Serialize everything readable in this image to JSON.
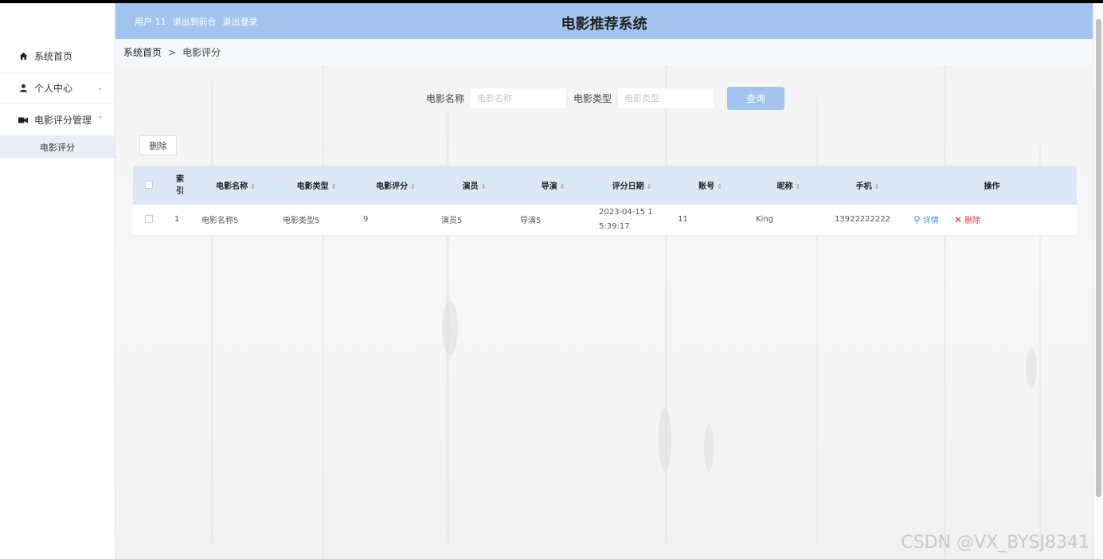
{
  "header": {
    "user_label": "用户 11",
    "to_front_label": "退出到前台",
    "logout_label": "退出登录",
    "title": "电影推荐系统",
    "color": "#a3c4ee"
  },
  "sidebar": {
    "items": [
      {
        "label": "系统首页",
        "icon": "home-icon"
      },
      {
        "label": "个人中心",
        "icon": "user-icon"
      },
      {
        "label": "电影评分管理",
        "icon": "film-icon"
      }
    ],
    "sub_items": [
      {
        "label": "电影评分"
      }
    ]
  },
  "breadcrumb": {
    "home": "系统首页",
    "separator": ">",
    "current": "电影评分"
  },
  "search": {
    "name_label": "电影名称",
    "name_placeholder": "电影名称",
    "type_label": "电影类型",
    "type_placeholder": "电影类型",
    "query_button": "查询"
  },
  "toolbar": {
    "delete_label": "删除"
  },
  "table": {
    "headers": {
      "index": "索引",
      "movie_name": "电影名称",
      "movie_type": "电影类型",
      "rating": "电影评分",
      "actor": "演员",
      "director": "导演",
      "date": "评分日期",
      "account": "账号",
      "nickname": "昵称",
      "phone": "手机",
      "actions": "操作"
    },
    "rows": [
      {
        "index": "1",
        "movie_name": "电影名称5",
        "movie_type": "电影类型5",
        "rating": "9",
        "actor": "演员5",
        "director": "导演5",
        "date": "2023-04-15 15:39:17",
        "account": "11",
        "nickname": "King",
        "phone": "13922222222",
        "detail_label": "详情",
        "delete_label": "删除"
      }
    ]
  },
  "watermark": "CSDN @VX_BYSJ8341"
}
